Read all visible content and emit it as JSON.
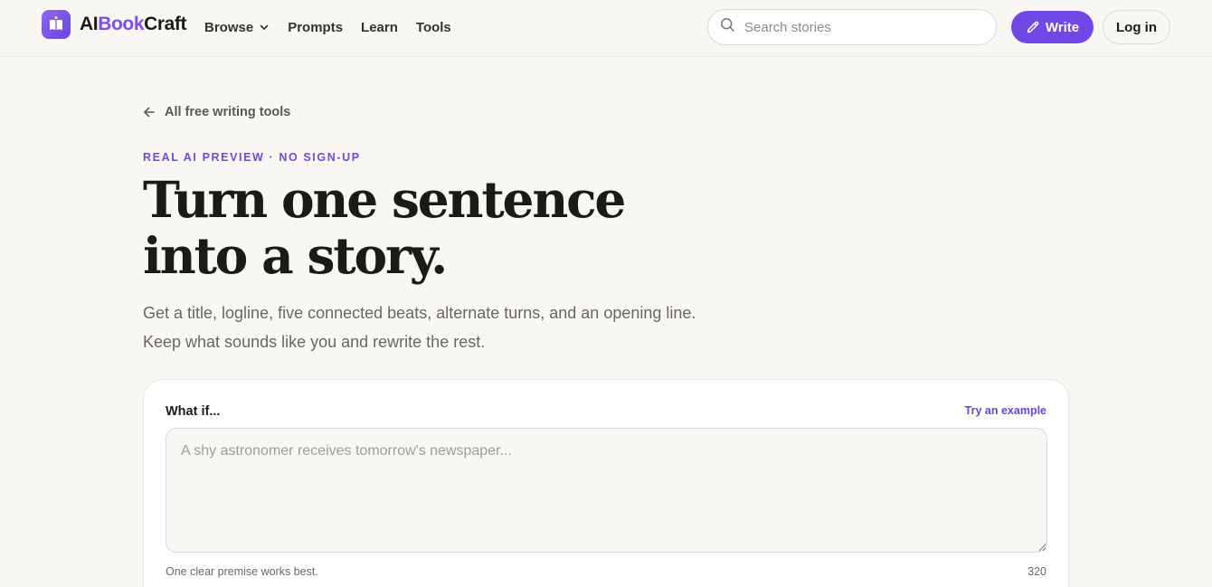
{
  "header": {
    "logo": {
      "prefix": "AI",
      "accent": "Book",
      "suffix": "Craft"
    },
    "nav": [
      {
        "label": "Browse",
        "has_dropdown": true
      },
      {
        "label": "Prompts"
      },
      {
        "label": "Learn"
      },
      {
        "label": "Tools"
      }
    ],
    "search": {
      "placeholder": "Search stories",
      "value": ""
    },
    "write_label": "Write",
    "login_label": "Log in"
  },
  "main": {
    "back_link": "All free writing tools",
    "eyebrow": "REAL AI PREVIEW · NO SIGN-UP",
    "headline": [
      "Turn one sentence",
      "into a story."
    ],
    "subhead": [
      "Get a title, logline, five connected beats, alternate turns, and an opening line.",
      "Keep what sounds like you and rewrite the rest."
    ]
  },
  "card": {
    "label": "What if...",
    "try_example": "Try an example",
    "placeholder": "A shy astronomer receives tomorrow's newspaper...",
    "value": "",
    "hint": "One clear premise works best.",
    "char_count": "320"
  },
  "icons": {
    "logo": "book-icon",
    "browse": "chevron-down-icon",
    "search": "search-icon",
    "write": "pencil-icon",
    "back": "arrow-left-icon"
  },
  "colors": {
    "accent": "#7048e8",
    "background": "#f8f7f4",
    "text": "#1c1b19",
    "muted": "#6a6762"
  }
}
